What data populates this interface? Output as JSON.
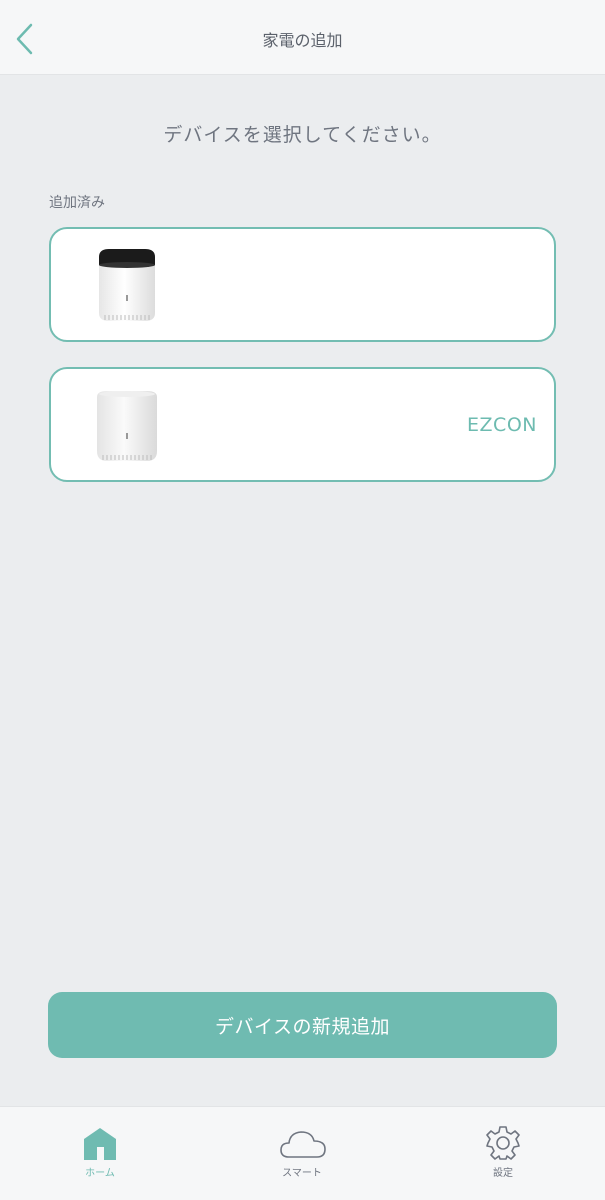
{
  "header": {
    "title": "家電の追加",
    "back_icon": "chevron-left-icon"
  },
  "prompt": "デバイスを選択してください。",
  "section_label": "追加済み",
  "devices": [
    {
      "name": "",
      "image": "rm-mini-black-top-icon"
    },
    {
      "name": "EZCON",
      "image": "rm-mini-white-icon"
    }
  ],
  "add_button": {
    "label": "デバイスの新規追加"
  },
  "tabs": [
    {
      "label": "ホーム",
      "icon": "home-icon",
      "active": true
    },
    {
      "label": "スマート",
      "icon": "cloud-icon",
      "active": false
    },
    {
      "label": "設定",
      "icon": "gear-icon",
      "active": false
    }
  ],
  "colors": {
    "accent": "#6fbbb1",
    "background": "#ebedef",
    "text": "#6f7580"
  }
}
